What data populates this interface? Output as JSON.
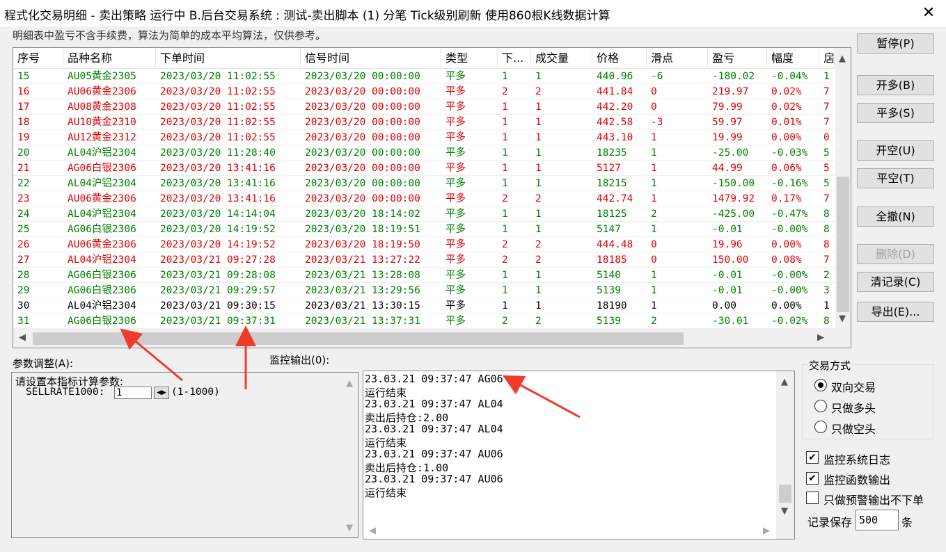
{
  "window": {
    "title": "程式化交易明细 - 卖出策略 运行中  B.后台交易系统 : 测试-卖出脚本 (1) 分笔 Tick级别刷新 使用860根K线数据计算",
    "close_glyph": "✕"
  },
  "note": "明细表中盈亏不含手续费，算法为简单的成本平均算法，仅供参考。",
  "colors": {
    "red": "#e00000",
    "green": "#008000",
    "black": "#000000"
  },
  "table": {
    "columns": [
      "序号",
      "品种名称",
      "下单时间",
      "信号时间",
      "类型",
      "下...",
      "成交量",
      "价格",
      "滑点",
      "盈亏",
      "幅度",
      "扂"
    ],
    "rows": [
      {
        "color": "green",
        "cells": [
          "15",
          "AU05黄金2305",
          "2023/03/20  11:02:55",
          "2023/03/20  00:00:00",
          "平多",
          "1",
          "1",
          "440.96",
          "-6",
          "-180.02",
          "-0.04%",
          "1"
        ]
      },
      {
        "color": "red",
        "cells": [
          "16",
          "AU06黄金2306",
          "2023/03/20  11:02:55",
          "2023/03/20  00:00:00",
          "平多",
          "2",
          "2",
          "441.84",
          "0",
          "219.97",
          "0.02%",
          "7"
        ]
      },
      {
        "color": "red",
        "cells": [
          "17",
          "AU08黄金2308",
          "2023/03/20  11:02:55",
          "2023/03/20  00:00:00",
          "平多",
          "1",
          "1",
          "442.20",
          "0",
          "79.99",
          "0.02%",
          "7"
        ]
      },
      {
        "color": "red",
        "cells": [
          "18",
          "AU10黄金2310",
          "2023/03/20  11:02:55",
          "2023/03/20  00:00:00",
          "平多",
          "1",
          "1",
          "442.58",
          "-3",
          "59.97",
          "0.01%",
          "7"
        ]
      },
      {
        "color": "red",
        "cells": [
          "19",
          "AU12黄金2312",
          "2023/03/20  11:02:55",
          "2023/03/20  00:00:00",
          "平多",
          "1",
          "1",
          "443.10",
          "1",
          "19.99",
          "0.00%",
          "0"
        ]
      },
      {
        "color": "green",
        "cells": [
          "20",
          "AL04沪铝2304",
          "2023/03/20  11:28:40",
          "2023/03/20  00:00:00",
          "平多",
          "1",
          "1",
          "18235",
          "1",
          "-25.00",
          "-0.03%",
          "5"
        ]
      },
      {
        "color": "red",
        "cells": [
          "21",
          "AG06白银2306",
          "2023/03/20  13:41:16",
          "2023/03/20  00:00:00",
          "平多",
          "1",
          "1",
          "5127",
          "1",
          "44.99",
          "0.06%",
          "5"
        ]
      },
      {
        "color": "green",
        "cells": [
          "22",
          "AL04沪铝2304",
          "2023/03/20  13:41:16",
          "2023/03/20  00:00:00",
          "平多",
          "1",
          "1",
          "18215",
          "1",
          "-150.00",
          "-0.16%",
          "5"
        ]
      },
      {
        "color": "red",
        "cells": [
          "23",
          "AU06黄金2306",
          "2023/03/20  13:41:16",
          "2023/03/20  00:00:00",
          "平多",
          "2",
          "2",
          "442.74",
          "1",
          "1479.92",
          "0.17%",
          "7"
        ]
      },
      {
        "color": "green",
        "cells": [
          "24",
          "AL04沪铝2304",
          "2023/03/20  14:14:04",
          "2023/03/20  18:14:02",
          "平多",
          "1",
          "1",
          "18125",
          "2",
          "-425.00",
          "-0.47%",
          "8"
        ]
      },
      {
        "color": "green",
        "cells": [
          "25",
          "AG06白银2306",
          "2023/03/20  14:19:52",
          "2023/03/20  18:19:51",
          "平多",
          "1",
          "1",
          "5147",
          "1",
          "-0.01",
          "-0.00%",
          "8"
        ]
      },
      {
        "color": "red",
        "cells": [
          "26",
          "AU06黄金2306",
          "2023/03/20  14:19:52",
          "2023/03/20  18:19:50",
          "平多",
          "2",
          "2",
          "444.48",
          "0",
          "19.96",
          "0.00%",
          "8"
        ]
      },
      {
        "color": "red",
        "cells": [
          "27",
          "AL04沪铝2304",
          "2023/03/21  09:27:28",
          "2023/03/21  13:27:22",
          "平多",
          "2",
          "2",
          "18185",
          "0",
          "150.00",
          "0.08%",
          "7"
        ]
      },
      {
        "color": "green",
        "cells": [
          "28",
          "AG06白银2306",
          "2023/03/21  09:28:08",
          "2023/03/21  13:28:08",
          "平多",
          "1",
          "1",
          "5140",
          "1",
          "-0.01",
          "-0.00%",
          "2"
        ]
      },
      {
        "color": "green",
        "cells": [
          "29",
          "AG06白银2306",
          "2023/03/21  09:29:57",
          "2023/03/21  13:29:56",
          "平多",
          "1",
          "1",
          "5139",
          "1",
          "-0.01",
          "-0.00%",
          "3"
        ]
      },
      {
        "color": "black",
        "cells": [
          "30",
          "AL04沪铝2304",
          "2023/03/21  09:30:15",
          "2023/03/21  13:30:15",
          "平多",
          "1",
          "1",
          "18190",
          "1",
          "0.00",
          "0.00%",
          "1"
        ]
      },
      {
        "color": "green",
        "cells": [
          "31",
          "AG06白银2306",
          "2023/03/21  09:37:31",
          "2023/03/21  13:37:31",
          "平多",
          "2",
          "2",
          "5139",
          "2",
          "-30.01",
          "-0.02%",
          "8"
        ]
      }
    ]
  },
  "buttons": {
    "pause": "暂停(P)",
    "open_long": "开多(B)",
    "close_long": "平多(S)",
    "open_short": "开空(U)",
    "close_short": "平空(T)",
    "cancel_all": "全撤(N)",
    "delete": "删除(D)",
    "clear_log": "清记录(C)",
    "export": "导出(E)..."
  },
  "params": {
    "label": "参数调整(A):",
    "prompt": "请设置本指标计算参数:",
    "name": "SELLRATE1000:",
    "value": "1",
    "range": "(1-1000)"
  },
  "monitor": {
    "label": "监控输出(0):",
    "lines": [
      "23.03.21 09:37:47 AG06",
      "运行结束",
      "23.03.21 09:37:47 AL04",
      "卖出后持仓:2.00",
      "23.03.21 09:37:47 AL04",
      "运行结束",
      "23.03.21 09:37:47 AU06",
      "卖出后持仓:1.00",
      "23.03.21 09:37:47 AU06",
      "运行结束"
    ]
  },
  "trade_mode": {
    "title": "交易方式",
    "options": [
      "双向交易",
      "只做多头",
      "只做空头"
    ],
    "selected": "双向交易"
  },
  "checkboxes": {
    "sys_log": {
      "label": "监控系统日志",
      "checked": true
    },
    "func_out": {
      "label": "监控函数输出",
      "checked": true
    },
    "warn_only": {
      "label": "只做预警输出不下单",
      "checked": false
    }
  },
  "record": {
    "prefix": "记录保存",
    "value": "500",
    "suffix": "条"
  }
}
